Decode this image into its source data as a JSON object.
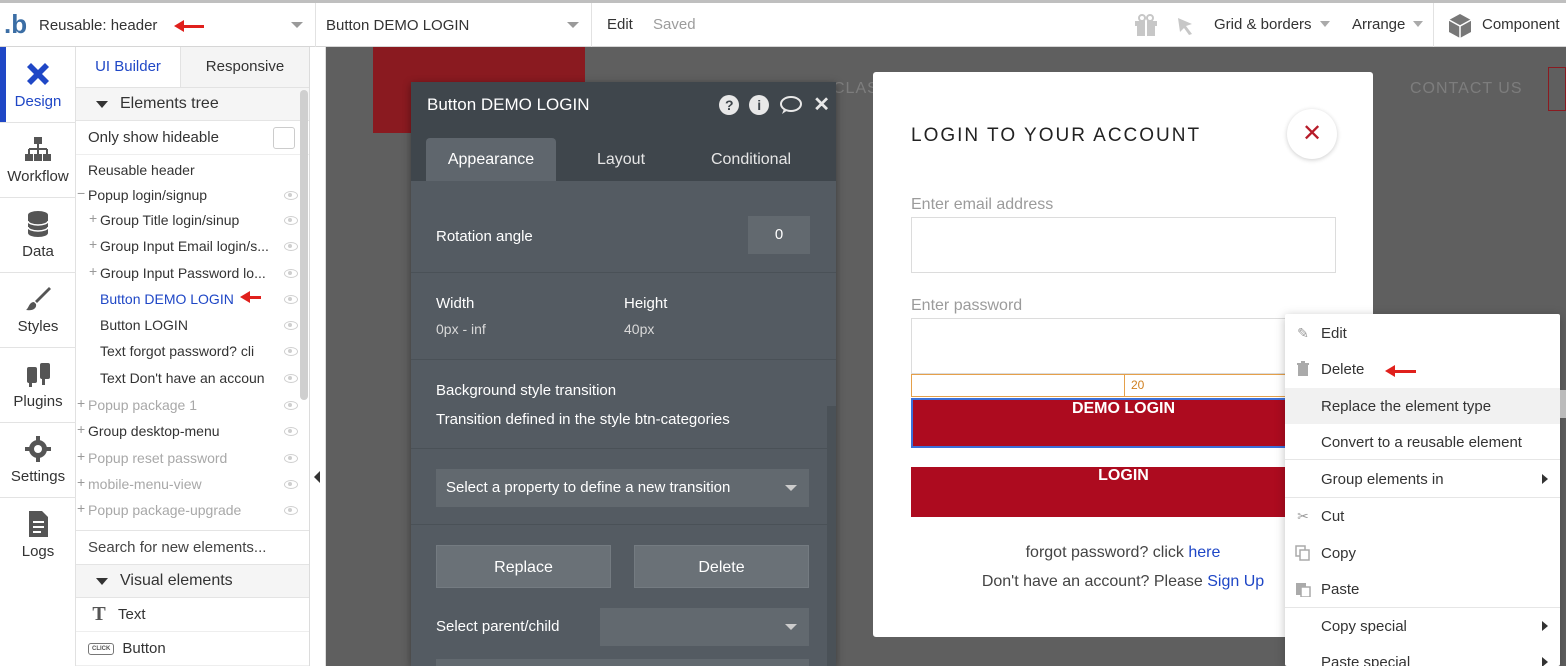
{
  "topbar": {
    "page_select": "Reusable: header",
    "element_select": "Button DEMO LOGIN",
    "edit": "Edit",
    "saved": "Saved",
    "grid": "Grid & borders",
    "arrange": "Arrange",
    "components": "Component"
  },
  "leftnav": [
    {
      "label": "Design"
    },
    {
      "label": "Workflow"
    },
    {
      "label": "Data"
    },
    {
      "label": "Styles"
    },
    {
      "label": "Plugins"
    },
    {
      "label": "Settings"
    },
    {
      "label": "Logs"
    }
  ],
  "panel": {
    "tab_ui": "UI Builder",
    "tab_responsive": "Responsive",
    "elements_tree": "Elements tree",
    "only_hideable": "Only show hideable",
    "tree": [
      {
        "label": "Reusable header"
      },
      {
        "label": "Popup login/signup"
      },
      {
        "label": "Group Title login/sinup"
      },
      {
        "label": "Group Input Email login/s..."
      },
      {
        "label": "Group Input Password lo..."
      },
      {
        "label": "Button DEMO LOGIN"
      },
      {
        "label": "Button LOGIN"
      },
      {
        "label": "Text forgot password? cli"
      },
      {
        "label": "Text Don't have an accoun"
      },
      {
        "label": "Popup package 1"
      },
      {
        "label": "Group desktop-menu"
      },
      {
        "label": "Popup reset password"
      },
      {
        "label": "mobile-menu-view"
      },
      {
        "label": "Popup package-upgrade"
      }
    ],
    "search_placeholder": "Search for new elements...",
    "visual_elements": "Visual elements",
    "vis_items": [
      {
        "label": "Text",
        "icon": "T"
      },
      {
        "label": "Button",
        "icon": "CLICK"
      }
    ]
  },
  "background": {
    "nav_1": "CLAS",
    "nav_2": "CONTACT US"
  },
  "editor": {
    "title": "Button DEMO LOGIN",
    "tabs": [
      "Appearance",
      "Layout",
      "Conditional"
    ],
    "rotation_label": "Rotation angle",
    "rotation_value": "0",
    "width_label": "Width",
    "width_value": "0px - inf",
    "height_label": "Height",
    "height_value": "40px",
    "bg_transition_label": "Background style transition",
    "bg_transition_note": "Transition defined in the style btn-categories",
    "transition_select": "Select a property to define a new transition",
    "replace": "Replace",
    "delete": "Delete",
    "parent_child": "Select parent/child"
  },
  "login": {
    "title": "LOGIN TO YOUR ACCOUNT",
    "email_label": "Enter email address",
    "password_label": "Enter password",
    "dim_value": "20",
    "demo_button": "DEMO LOGIN",
    "login_button": "LOGIN",
    "forgot_text": "forgot password? click",
    "forgot_link": "here",
    "signup_text": "Don't have an account? Please",
    "signup_link": "Sign Up"
  },
  "context_menu": {
    "items": [
      {
        "label": "Edit",
        "icon": "pencil-icon"
      },
      {
        "label": "Delete",
        "icon": "trash-icon"
      },
      {
        "label": "Replace the element type"
      },
      {
        "label": "Convert to a reusable element"
      },
      {
        "label": "Group elements in"
      },
      {
        "label": "Cut",
        "icon": "scissors-icon"
      },
      {
        "label": "Copy",
        "icon": "copy-icon"
      },
      {
        "label": "Paste",
        "icon": "paste-icon"
      },
      {
        "label": "Copy special"
      },
      {
        "label": "Paste special"
      }
    ]
  },
  "colors": {
    "accent_blue": "#1f47c6",
    "brand_red": "#ad0b1f",
    "annotation_red": "#e0201c"
  }
}
